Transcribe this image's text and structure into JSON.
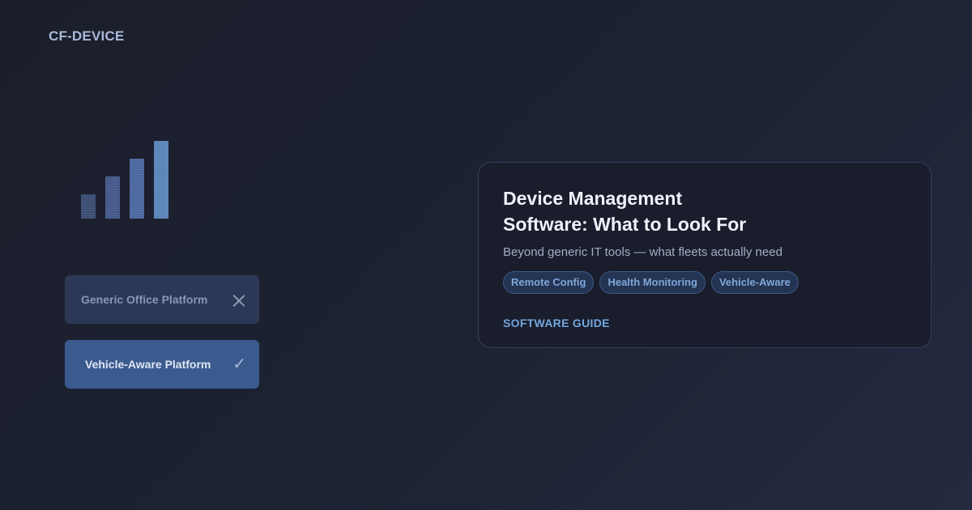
{
  "brand": "CF-DEVICE",
  "comparison": {
    "generic": {
      "label": "Generic Office Platform",
      "icon": "close-icon"
    },
    "vehicle": {
      "label": "Vehicle-Aware Platform",
      "icon": "check-icon",
      "mark": "✓"
    }
  },
  "card": {
    "title": "Device Management Software: What to Look For",
    "subtitle": "Beyond generic IT tools — what fleets actually need",
    "tags": [
      "Remote Config",
      "Health Monitoring",
      "Vehicle-Aware"
    ],
    "category": "SOFTWARE GUIDE"
  },
  "colors": {
    "background": "#1d2233",
    "accent": "#74a6dc",
    "selected_option": "#3b5b8f"
  }
}
